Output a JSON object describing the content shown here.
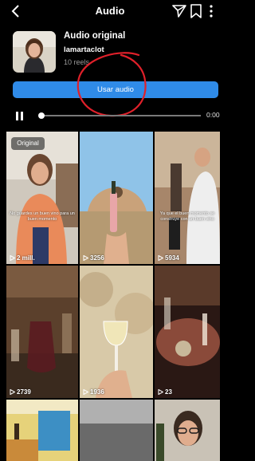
{
  "header": {
    "title": "Audio"
  },
  "audio": {
    "name": "Audio original",
    "username": "lamartaclot",
    "reels_count": "10 reels",
    "use_button": "Usar audio"
  },
  "player": {
    "time": "0:00",
    "progress": 0
  },
  "colors": {
    "accent": "#2f8be8",
    "annotation_ring": "#e0202a",
    "background": "#000000"
  },
  "reels": [
    {
      "views": "2 mill.",
      "badge": "Original",
      "caption": "No guardes un buen vino para un buen momento"
    },
    {
      "views": "3256"
    },
    {
      "views": "5934",
      "caption": "Ya que el buen momento se construye con un buen vino"
    },
    {
      "views": "2739"
    },
    {
      "views": "1936"
    },
    {
      "views": "23"
    },
    {
      "views": ""
    },
    {
      "views": ""
    },
    {
      "views": ""
    }
  ]
}
